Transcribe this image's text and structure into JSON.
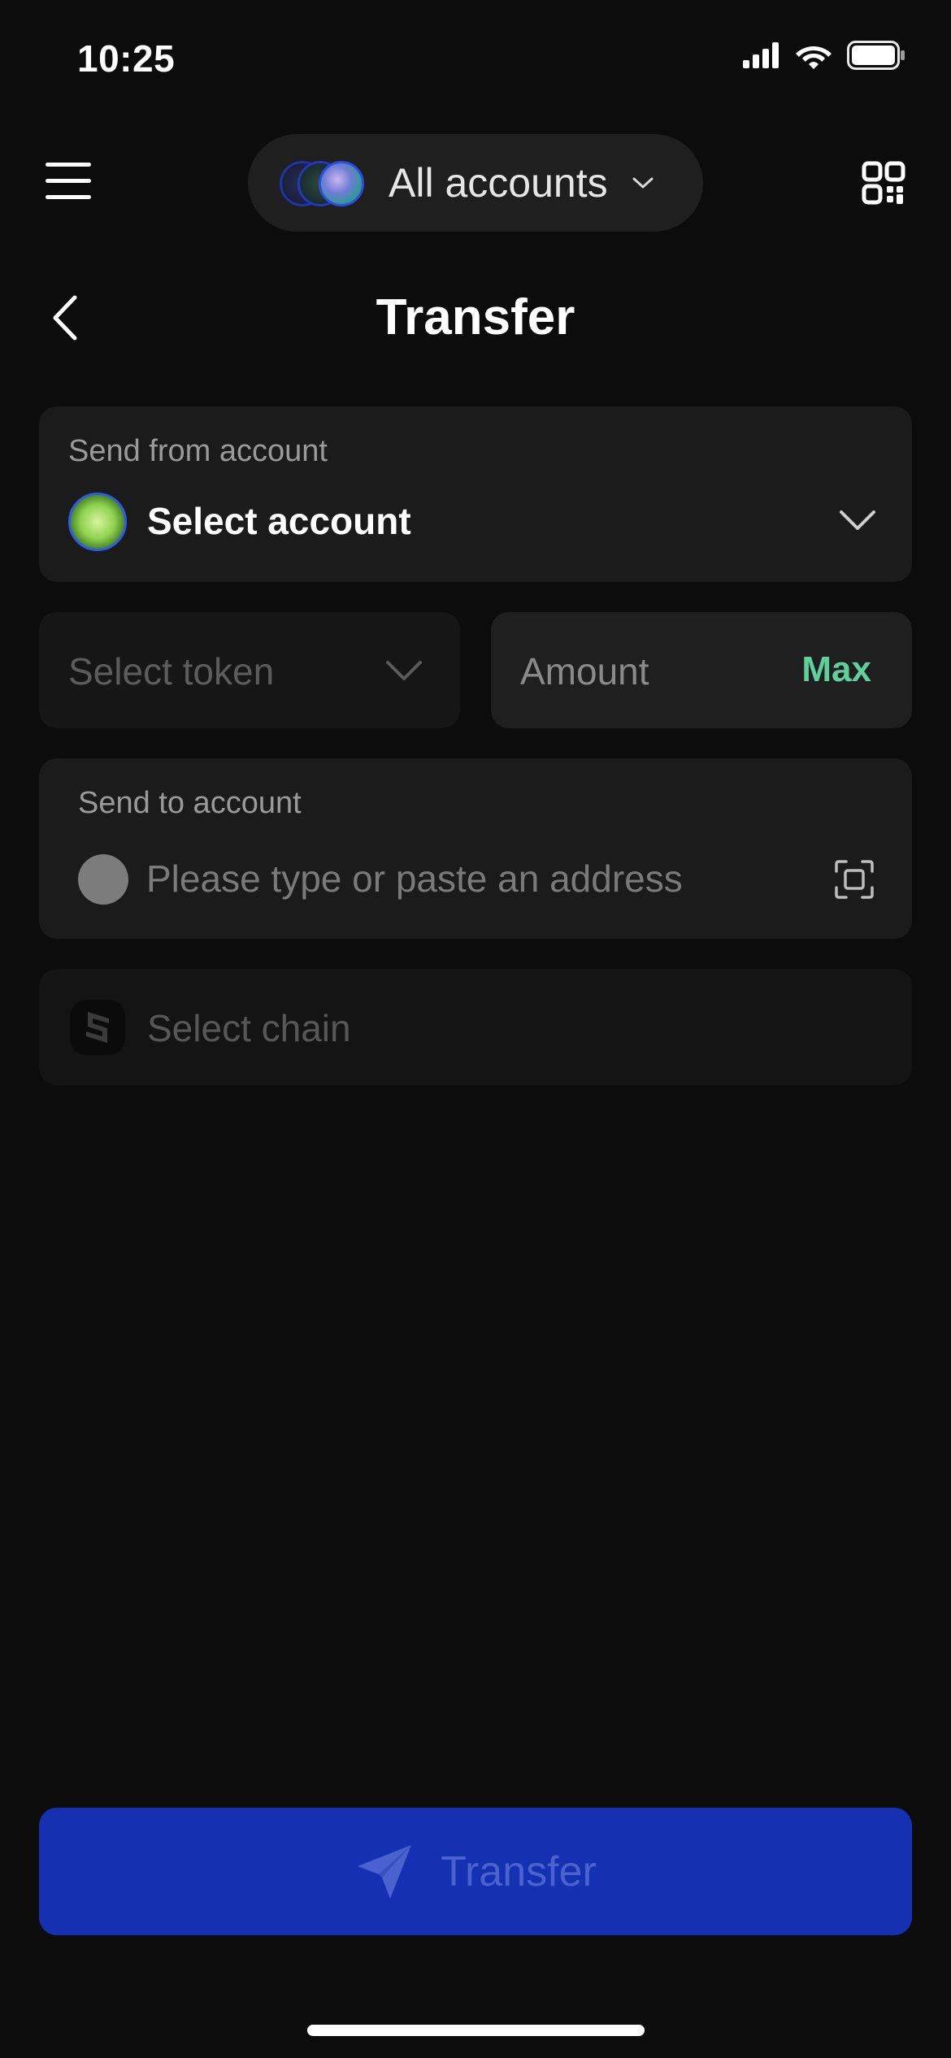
{
  "status_bar": {
    "time": "10:25",
    "icons": [
      "cellular-signal-icon",
      "wifi-icon",
      "battery-icon"
    ]
  },
  "header": {
    "menu_icon": "hamburger-menu-icon",
    "account_selector": "All accounts",
    "qr_icon": "qr-code-icon"
  },
  "page": {
    "back_icon": "chevron-left-icon",
    "title": "Transfer"
  },
  "form": {
    "from": {
      "label": "Send from account",
      "value": "Select account"
    },
    "token": {
      "label": "Select token"
    },
    "amount": {
      "placeholder": "Amount",
      "max_label": "Max"
    },
    "to": {
      "label": "Send to account",
      "placeholder": "Please type or paste an address"
    },
    "chain": {
      "label": "Select chain"
    }
  },
  "actions": {
    "transfer_label": "Transfer"
  },
  "colors": {
    "background": "#0c0c0c",
    "card": "#1b1b1b",
    "primary_button": "#1530b0",
    "primary_button_text": "#4a62cf",
    "max_accent": "#5fd09b",
    "avatar_ring": "#2f5be8"
  }
}
